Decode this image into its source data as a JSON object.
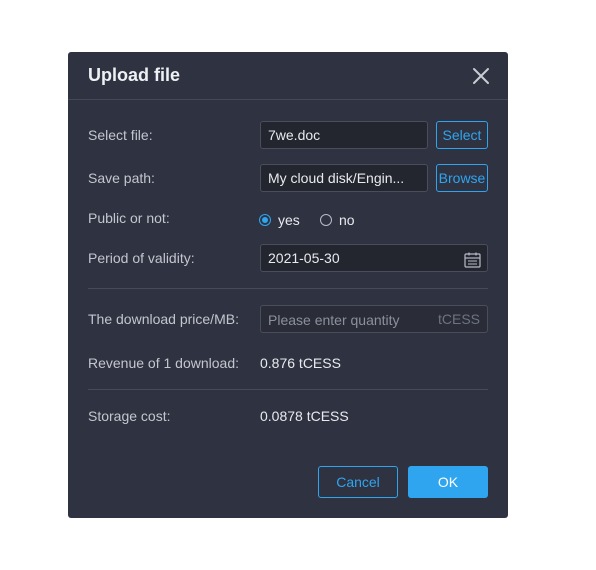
{
  "dialog": {
    "title": "Upload file",
    "close_icon": "close-icon"
  },
  "form": {
    "select_file": {
      "label": "Select file:",
      "value": "7we.doc",
      "button_label": "Select"
    },
    "save_path": {
      "label": "Save path:",
      "value": "My cloud disk/Engin...",
      "button_label": "Browse"
    },
    "public": {
      "label": "Public or not:",
      "options": [
        {
          "label": "yes",
          "checked": true
        },
        {
          "label": "no",
          "checked": false
        }
      ]
    },
    "validity": {
      "label": "Period of validity:",
      "value": "2021-05-30",
      "icon": "calendar-icon"
    },
    "download_price": {
      "label": "The download price/MB:",
      "placeholder": "Please enter quantity",
      "unit": "tCESS"
    },
    "revenue": {
      "label": "Revenue of 1 download:",
      "value": "0.876 tCESS"
    },
    "storage_cost": {
      "label": "Storage cost:",
      "value": "0.0878 tCESS"
    }
  },
  "actions": {
    "cancel_label": "Cancel",
    "ok_label": "OK"
  },
  "colors": {
    "dialog_bg": "#2f3240",
    "accent": "#2fa5f0",
    "field_bg": "#23252f"
  }
}
